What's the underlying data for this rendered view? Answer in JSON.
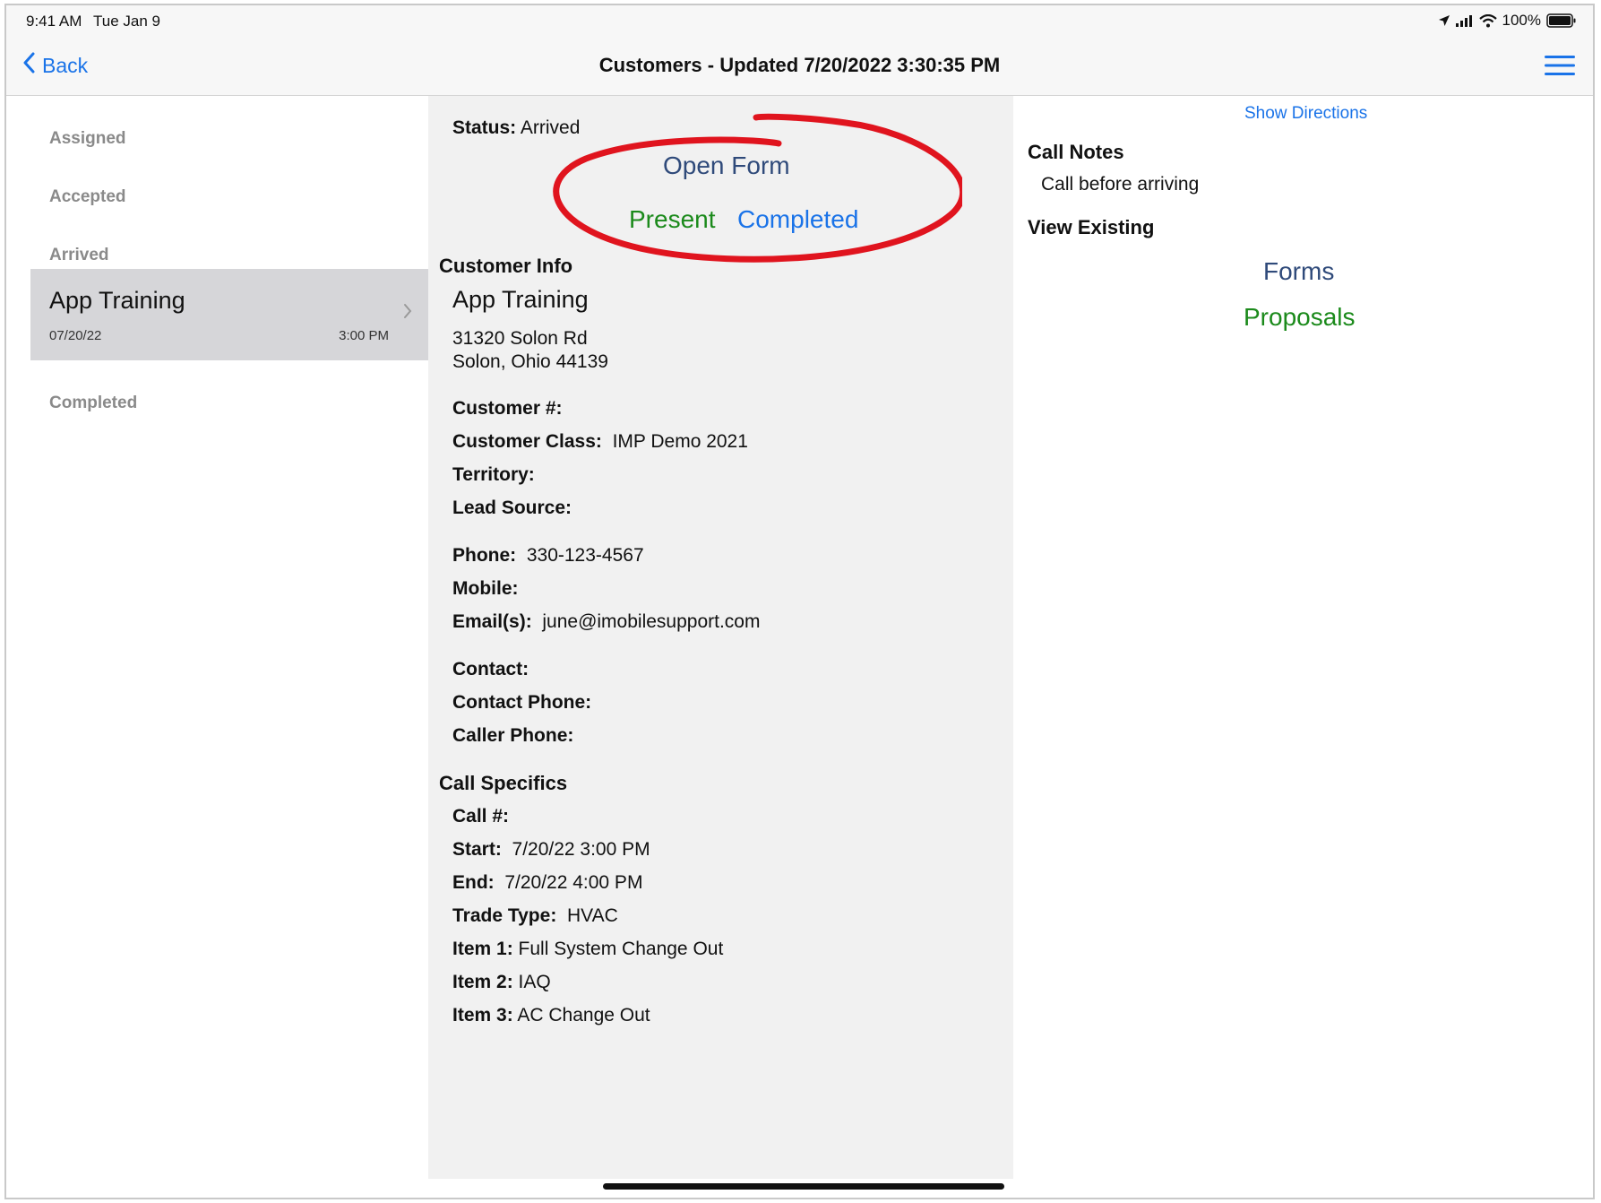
{
  "status_bar": {
    "time": "9:41 AM",
    "date": "Tue Jan 9",
    "battery": "100%"
  },
  "nav": {
    "back_label": "Back",
    "title": "Customers - Updated 7/20/2022 3:30:35 PM",
    "menu_icon": "hamburger-menu-icon"
  },
  "sidebar": {
    "sections": [
      "Assigned",
      "Accepted",
      "Arrived",
      "Completed"
    ],
    "selected_item": {
      "title": "App Training",
      "date": "07/20/22",
      "time": "3:00 PM"
    }
  },
  "detail": {
    "status_label": "Status:",
    "status_value": "Arrived",
    "actions": {
      "open_form": "Open Form",
      "present": "Present",
      "completed": "Completed"
    },
    "customer_info_header": "Customer Info",
    "customer_name": "App Training",
    "address_line1": "31320 Solon Rd",
    "address_line2": "Solon, Ohio 44139",
    "fields_group1": [
      {
        "label": "Customer #:",
        "value": ""
      },
      {
        "label": "Customer Class:",
        "value": "IMP Demo 2021"
      },
      {
        "label": "Territory:",
        "value": ""
      },
      {
        "label": "Lead Source:",
        "value": ""
      }
    ],
    "fields_group2": [
      {
        "label": "Phone:",
        "value": "330-123-4567"
      },
      {
        "label": "Mobile:",
        "value": ""
      },
      {
        "label": "Email(s):",
        "value": "june@imobilesupport.com"
      }
    ],
    "fields_group3": [
      {
        "label": "Contact:",
        "value": ""
      },
      {
        "label": "Contact Phone:",
        "value": ""
      },
      {
        "label": "Caller Phone:",
        "value": ""
      }
    ],
    "call_specifics_header": "Call Specifics",
    "fields_group4": [
      {
        "label": "Call #:",
        "value": ""
      },
      {
        "label": "Start:",
        "value": "7/20/22 3:00 PM"
      },
      {
        "label": "End:",
        "value": "7/20/22 4:00 PM"
      },
      {
        "label": "Trade Type:",
        "value": "HVAC"
      },
      {
        "label": "Item 1:",
        "value": "Full System Change Out"
      },
      {
        "label": "Item 2:",
        "value": "IAQ"
      },
      {
        "label": "Item 3:",
        "value": "AC Change Out"
      }
    ]
  },
  "right": {
    "show_directions": "Show Directions",
    "call_notes_header": "Call Notes",
    "call_notes_text": "Call before arriving",
    "view_existing_header": "View Existing",
    "forms_link": "Forms",
    "proposals_link": "Proposals"
  },
  "colors": {
    "accent_blue": "#1a73e8",
    "navy": "#2f4a7a",
    "green": "#1b8a1b",
    "annotation_red": "#e0141e"
  }
}
